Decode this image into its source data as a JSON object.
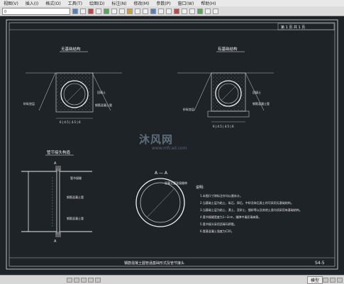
{
  "menubar": {
    "items": [
      "视图(V)",
      "插入(I)",
      "格式(O)",
      "工具(T)",
      "绘图(D)",
      "标注(N)",
      "修改(M)",
      "参数(P)",
      "窗口(W)",
      "帮助(H)"
    ]
  },
  "toolbar": {
    "layer_select": "0"
  },
  "drawing": {
    "page_box": "第 1 页  共 1 页",
    "left_section_title": "无基础结构",
    "right_section_title": "有基础结构",
    "pipe_section_title": "管节接头构造",
    "section_aa_title": "A — A",
    "section_aa_label": "混凝土管及接缝带",
    "notes_title": "说明:",
    "notes": [
      "1.本图尺寸除标注外均以厘米计。",
      "2.当基础土层为粘土、砾石、卵石、中砂及碎石类土时可采用无基础结构。",
      "3.当基础土层为粘土、黄土、亚砂土、细砂等以及其他土类均须采用有基础结构。",
      "4.管节接缝宽度为1~2cm，缝隙中填沥青麻絮。",
      "5.管节接头采用沥青玛蹄脂。",
      "6.管基混凝土强度为C20。"
    ],
    "drawing_title": "钢筋混凝土圆管涵基础形式及管节接头",
    "sheet_number": "S4-5",
    "label_pipe": "钢筋混凝土管",
    "label_cushion": "砂砾垫层",
    "label_backfill": "回填土",
    "label_joint": "管节接缝"
  },
  "watermark": {
    "text": "沐风网",
    "url": "www.mfcad.com"
  },
  "statusbar": {
    "coords": "",
    "model_tab": "模型"
  }
}
